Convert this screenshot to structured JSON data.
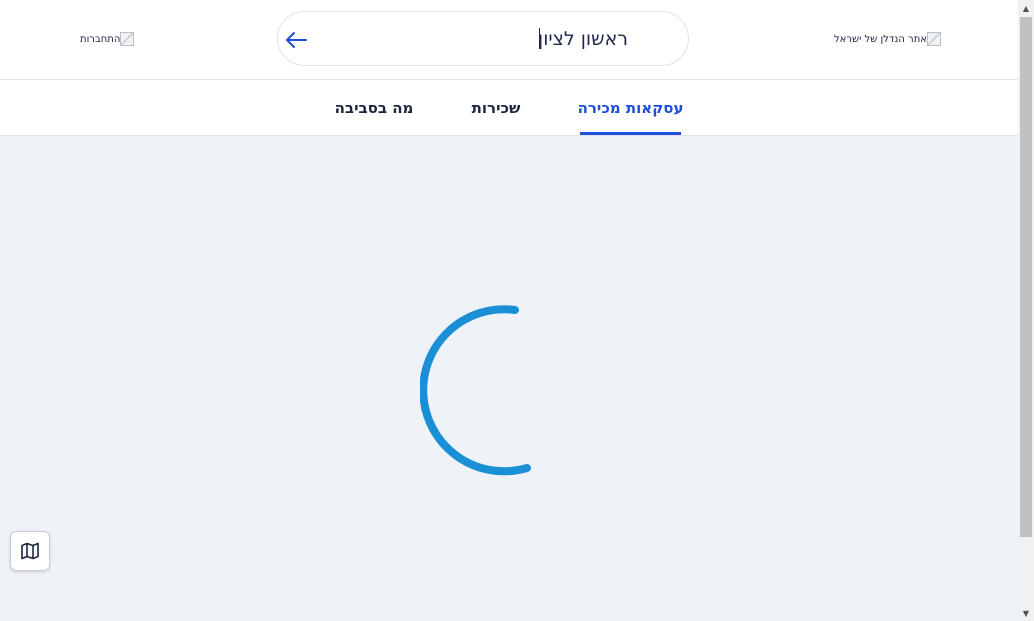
{
  "header": {
    "logo_alt": "אתר הנדלן של ישראל",
    "login_alt": "התחברות",
    "search": {
      "value": "ראשון לציון"
    },
    "back_icon": "arrow-left-icon"
  },
  "tabs": [
    {
      "label": "עסקאות מכירה",
      "active": true
    },
    {
      "label": "שכירות",
      "active": false
    },
    {
      "label": "מה בסביבה",
      "active": false
    }
  ],
  "main": {
    "loading": true,
    "spinner_icon": "loading-spinner-icon"
  },
  "map_button": {
    "icon": "map-icon"
  },
  "colors": {
    "accent": "#1d4ed8",
    "spinner": "#1a8fd6",
    "text": "#1c2440",
    "background": "#eff3f8"
  }
}
